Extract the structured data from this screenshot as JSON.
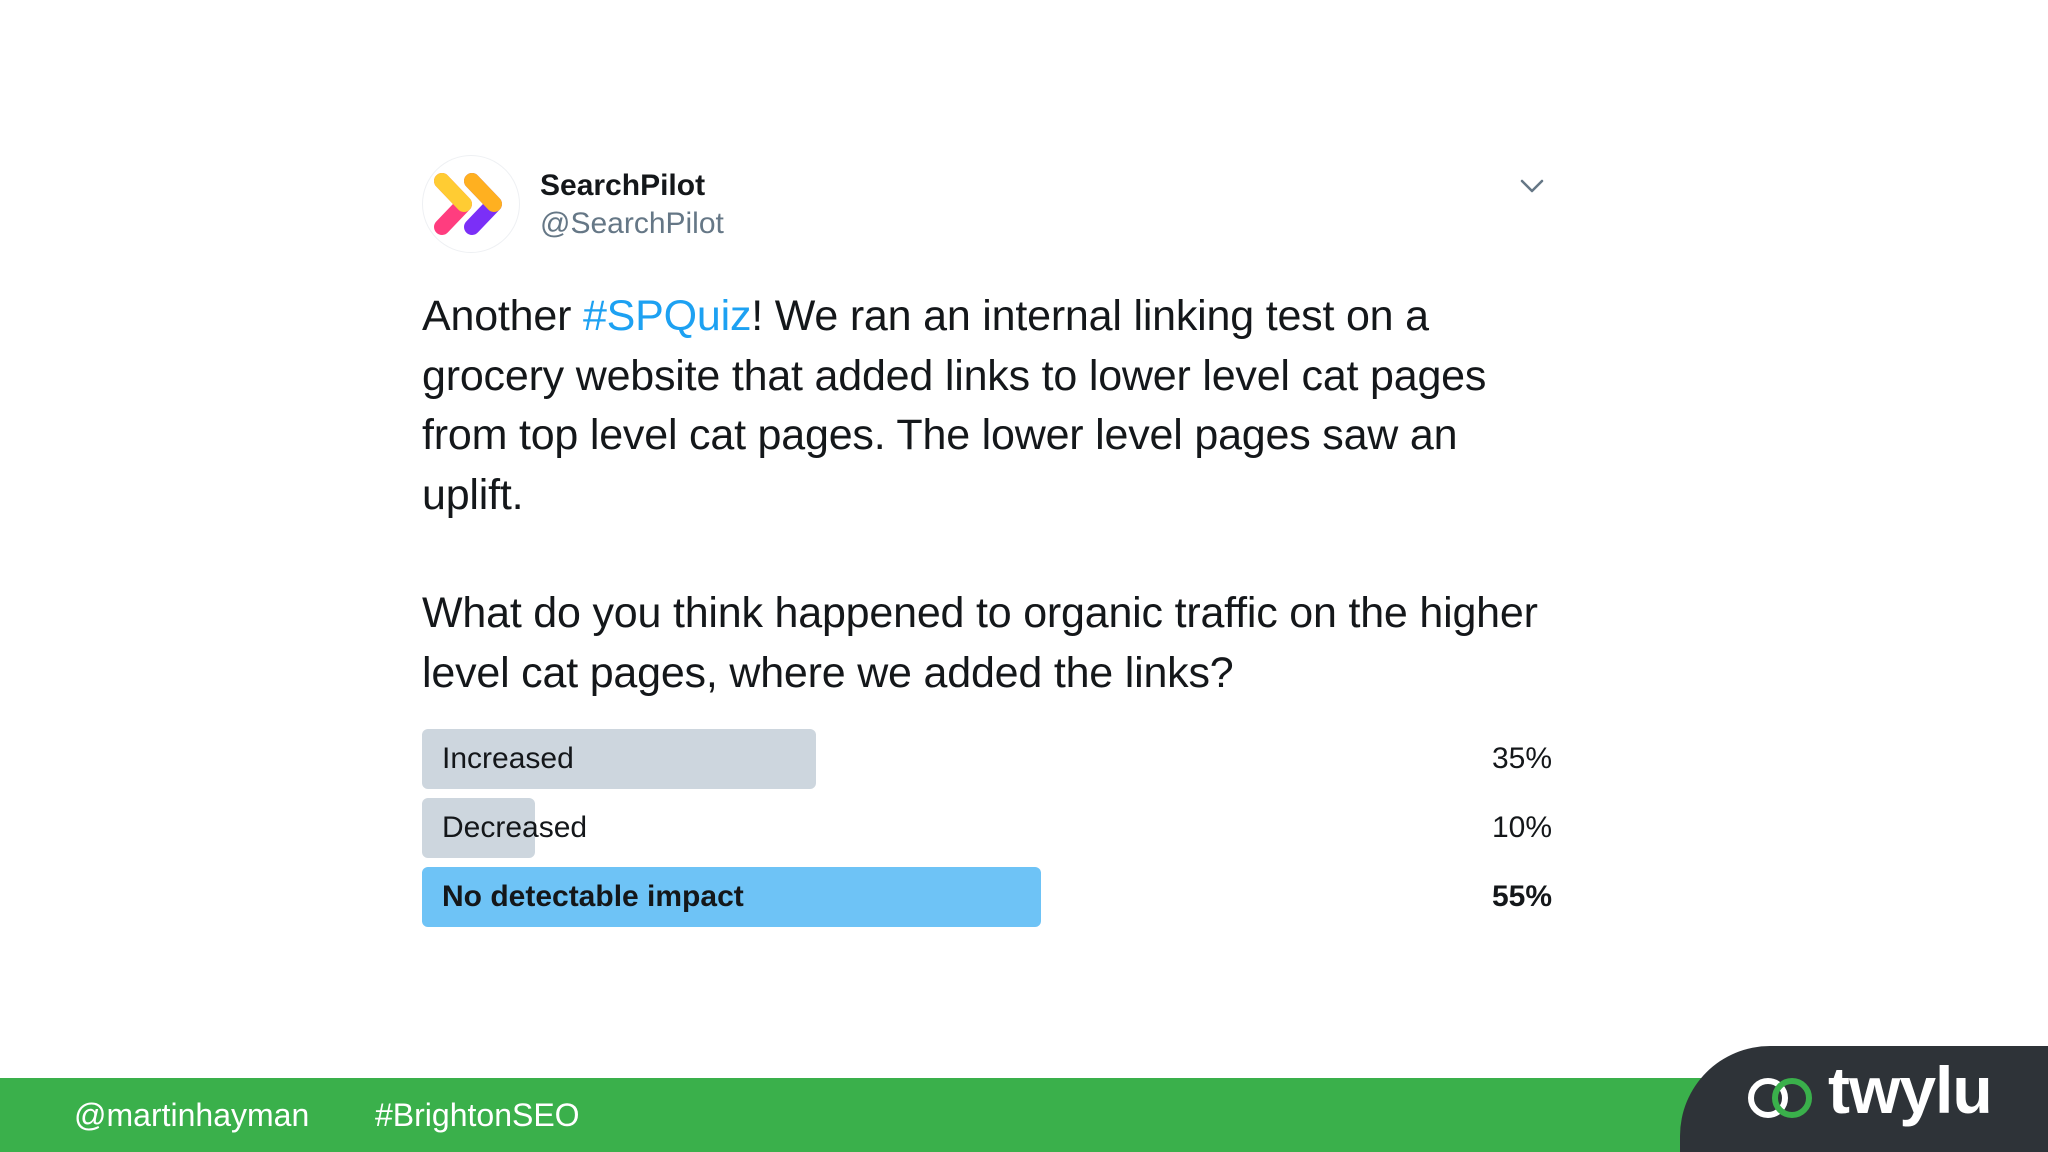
{
  "tweet": {
    "author_name": "SearchPilot",
    "author_handle": "@SearchPilot",
    "avatar_icon": "searchpilot-chevrons-logo",
    "menu_icon": "chevron-down-icon",
    "text_part1": "Another ",
    "hashtag": "#SPQuiz",
    "text_part2": "! We ran an internal linking test on a grocery website that added links to lower level cat pages from top level cat pages. The lower level pages saw an uplift.",
    "question": "What do you think happened to organic traffic on the higher level cat pages, where we added the links?",
    "hashtag_color": "#1da1f2"
  },
  "poll": {
    "options": [
      {
        "label": "Increased",
        "percent_text": "35%",
        "value": 35,
        "winner": false
      },
      {
        "label": "Decreased",
        "percent_text": "10%",
        "value": 10,
        "winner": false
      },
      {
        "label": "No detectable impact",
        "percent_text": "55%",
        "value": 55,
        "winner": true
      }
    ],
    "bar_color": "#cdd6de",
    "winner_color": "#6ec3f6"
  },
  "footer": {
    "handle": "@martinhayman",
    "tag": "#BrightonSEO",
    "color": "#3ab04b"
  },
  "brand": {
    "name": "twylu",
    "icon": "twylu-link-logo"
  }
}
